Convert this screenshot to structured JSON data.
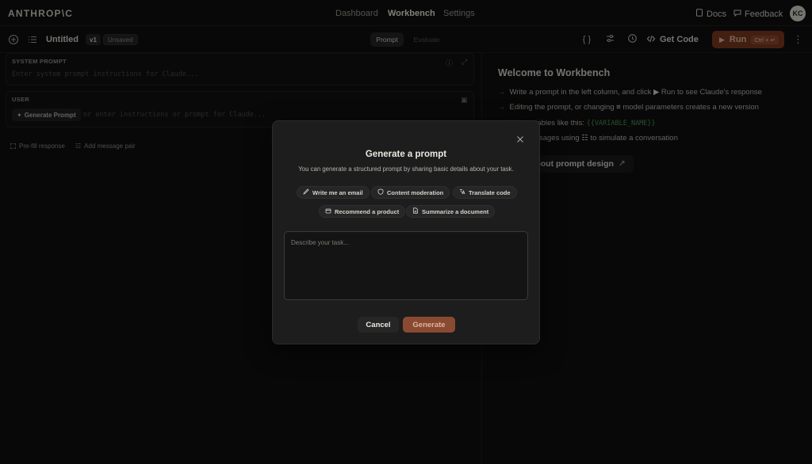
{
  "app": {
    "logo": "ANTHROP\\C",
    "nav": [
      "Dashboard",
      "Workbench",
      "Settings"
    ],
    "docs": "Docs",
    "feedback": "Feedback",
    "avatar": "KC"
  },
  "toolbar": {
    "title": "Untitled",
    "version": "v1",
    "status": "Unsaved",
    "tabs": [
      "Prompt",
      "Evaluate"
    ],
    "vars_icon": "{ }",
    "get_code": "Get Code",
    "run": "Run",
    "run_shortcut": "Ctrl + ↵"
  },
  "editor": {
    "system_label": "SYSTEM PROMPT",
    "system_placeholder": "Enter system prompt instructions for Claude...",
    "user_label": "USER",
    "generate_prompt": "Generate Prompt",
    "user_placeholder": "or enter instructions or prompt for Claude...",
    "prefill": "Pre-fill response",
    "add_pair": "Add message pair"
  },
  "welcome": {
    "title": "Welcome to Workbench",
    "line1_a": "Write a prompt in the left column, and click",
    "line1_b": "Run to see Claude's response",
    "line2_a": "Editing the prompt, or changing",
    "line2_b": "model parameters creates a new version",
    "line3_a": "Use variables like this:",
    "line3_var": "{{VARIABLE_NAME}}",
    "line4_a": "Add messages using",
    "line4_b": "to simulate a conversation",
    "learn": "Learn about prompt design"
  },
  "modal": {
    "title": "Generate a prompt",
    "subtitle": "You can generate a structured prompt by sharing basic details about your task.",
    "chips": [
      "Write me an email",
      "Content moderation",
      "Translate code",
      "Recommend a product",
      "Summarize a document"
    ],
    "task_placeholder": "Describe your task...",
    "cancel": "Cancel",
    "generate": "Generate"
  },
  "colors": {
    "accent": "#8a4a31",
    "run_bg": "#7a3a22",
    "variable_green": "#4c8f52",
    "background": "#0f0f0f"
  }
}
